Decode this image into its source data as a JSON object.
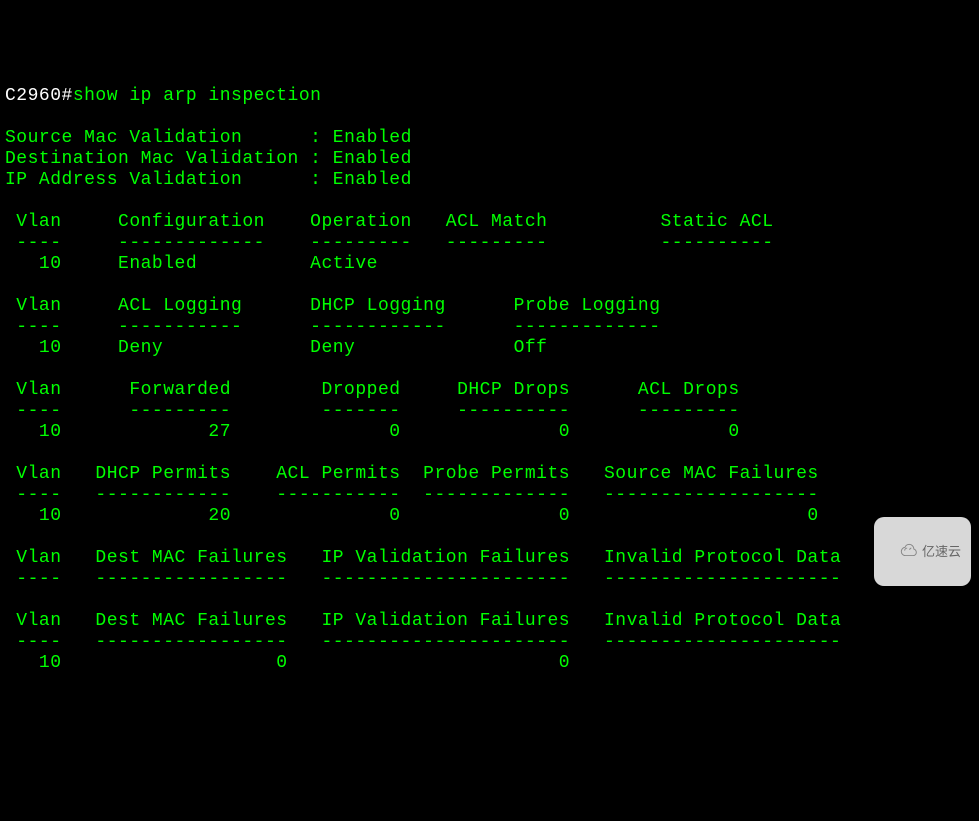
{
  "prompt": "C2960#",
  "command": "show ip arp inspection",
  "validation": {
    "source_mac_label": "Source Mac Validation      : ",
    "source_mac_value": "Enabled",
    "dest_mac_label": "Destination Mac Validation : ",
    "dest_mac_value": "Enabled",
    "ip_addr_label": "IP Address Validation      : ",
    "ip_addr_value": "Enabled"
  },
  "tables": {
    "t1": {
      "header": " Vlan     Configuration    Operation   ACL Match          Static ACL",
      "sep": " ----     -------------    ---------   ---------          ----------",
      "row": "   10     Enabled          Active"
    },
    "t2": {
      "header": " Vlan     ACL Logging      DHCP Logging      Probe Logging",
      "sep": " ----     -----------      ------------      -------------",
      "row": "   10     Deny             Deny              Off"
    },
    "t3": {
      "header": " Vlan      Forwarded        Dropped     DHCP Drops      ACL Drops",
      "sep": " ----      ---------        -------     ----------      ---------",
      "row": "   10             27              0              0              0"
    },
    "t4": {
      "header": " Vlan   DHCP Permits    ACL Permits  Probe Permits   Source MAC Failures",
      "sep": " ----   ------------    -----------  -------------   -------------------",
      "row": "   10             20              0              0                     0"
    },
    "t5": {
      "header": " Vlan   Dest MAC Failures   IP Validation Failures   Invalid Protocol Data",
      "sep": " ----   -----------------   ----------------------   ---------------------"
    },
    "t6": {
      "header": " Vlan   Dest MAC Failures   IP Validation Failures   Invalid Protocol Data",
      "sep": " ----   -----------------   ----------------------   ---------------------",
      "row": "   10                   0                        0"
    }
  },
  "watermark_text": "亿速云"
}
